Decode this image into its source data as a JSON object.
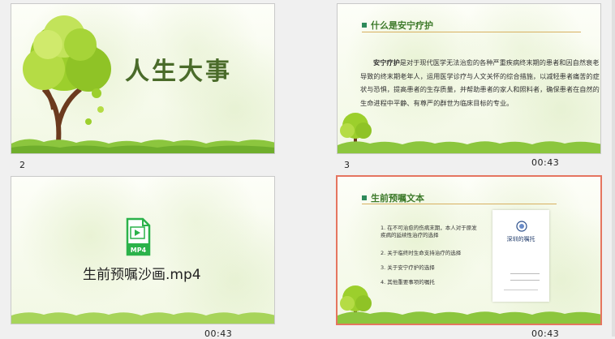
{
  "slides": [
    {
      "number": "2",
      "title": "人生大事",
      "time": ""
    },
    {
      "number": "3",
      "title": "什么是安宁疗护",
      "bold_term": "安宁疗护",
      "body": "是对于现代医学无法治愈的各种严重疾病终末期的患者和因自然衰老导致的终末期老年人，运用医学诊疗与人文关怀的综合措施，以减轻患者痛苦的症状与恐惧，提高患者的生存质量，并帮助患者的家人和照料者，确保患者在自然的生命进程中平静、有尊严的群世为临床目标的专业。",
      "time": "00:43"
    },
    {
      "number": "",
      "file_label": "生前预嘱沙画.mp4",
      "icon_text": "MP4",
      "time": "00:43"
    },
    {
      "number": "",
      "title": "生前预嘱文本",
      "items": [
        "1. 在不可治愈的伤病末期，本人对于原发疾病的延续性治疗的选择",
        "2. 关于临终时生命支持治疗的选择",
        "3. 关于安宁疗护的选择",
        "4. 其他重要事项的嘱托"
      ],
      "doc_title": "深圳的嘱托",
      "time": "00:43"
    }
  ],
  "colors": {
    "accent": "#e57560",
    "title_green": "#3d7a2a"
  }
}
